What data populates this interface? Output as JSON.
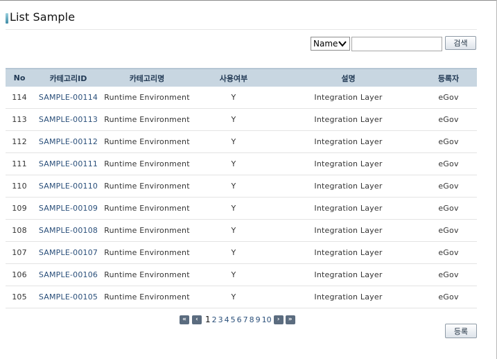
{
  "page": {
    "title": "List Sample"
  },
  "search": {
    "select_value": "Name",
    "input_value": "",
    "button_label": "검색"
  },
  "table": {
    "headers": [
      "No",
      "카테고리ID",
      "카테고리명",
      "사용여부",
      "설명",
      "등록자"
    ],
    "rows": [
      {
        "no": "114",
        "id": "SAMPLE-00114",
        "name": "Runtime Environment",
        "use": "Y",
        "desc": "Integration Layer",
        "reg": "eGov"
      },
      {
        "no": "113",
        "id": "SAMPLE-00113",
        "name": "Runtime Environment",
        "use": "Y",
        "desc": "Integration Layer",
        "reg": "eGov"
      },
      {
        "no": "112",
        "id": "SAMPLE-00112",
        "name": "Runtime Environment",
        "use": "Y",
        "desc": "Integration Layer",
        "reg": "eGov"
      },
      {
        "no": "111",
        "id": "SAMPLE-00111",
        "name": "Runtime Environment",
        "use": "Y",
        "desc": "Integration Layer",
        "reg": "eGov"
      },
      {
        "no": "110",
        "id": "SAMPLE-00110",
        "name": "Runtime Environment",
        "use": "Y",
        "desc": "Integration Layer",
        "reg": "eGov"
      },
      {
        "no": "109",
        "id": "SAMPLE-00109",
        "name": "Runtime Environment",
        "use": "Y",
        "desc": "Integration Layer",
        "reg": "eGov"
      },
      {
        "no": "108",
        "id": "SAMPLE-00108",
        "name": "Runtime Environment",
        "use": "Y",
        "desc": "Integration Layer",
        "reg": "eGov"
      },
      {
        "no": "107",
        "id": "SAMPLE-00107",
        "name": "Runtime Environment",
        "use": "Y",
        "desc": "Integration Layer",
        "reg": "eGov"
      },
      {
        "no": "106",
        "id": "SAMPLE-00106",
        "name": "Runtime Environment",
        "use": "Y",
        "desc": "Integration Layer",
        "reg": "eGov"
      },
      {
        "no": "105",
        "id": "SAMPLE-00105",
        "name": "Runtime Environment",
        "use": "Y",
        "desc": "Integration Layer",
        "reg": "eGov"
      }
    ]
  },
  "pagination": {
    "first_icon": "double-chevron-left-icon",
    "prev_icon": "chevron-left-icon",
    "next_icon": "chevron-right-icon",
    "last_icon": "double-chevron-right-icon",
    "current": "1",
    "pages": [
      "2",
      "3",
      "4",
      "5",
      "6",
      "7",
      "8",
      "9",
      "10"
    ]
  },
  "register_button_label": "등록",
  "colors": {
    "header_bg": "#c8d6e1",
    "header_text": "#223a55",
    "link": "#2a4f7a",
    "pager_button": "#5b6c7f"
  }
}
